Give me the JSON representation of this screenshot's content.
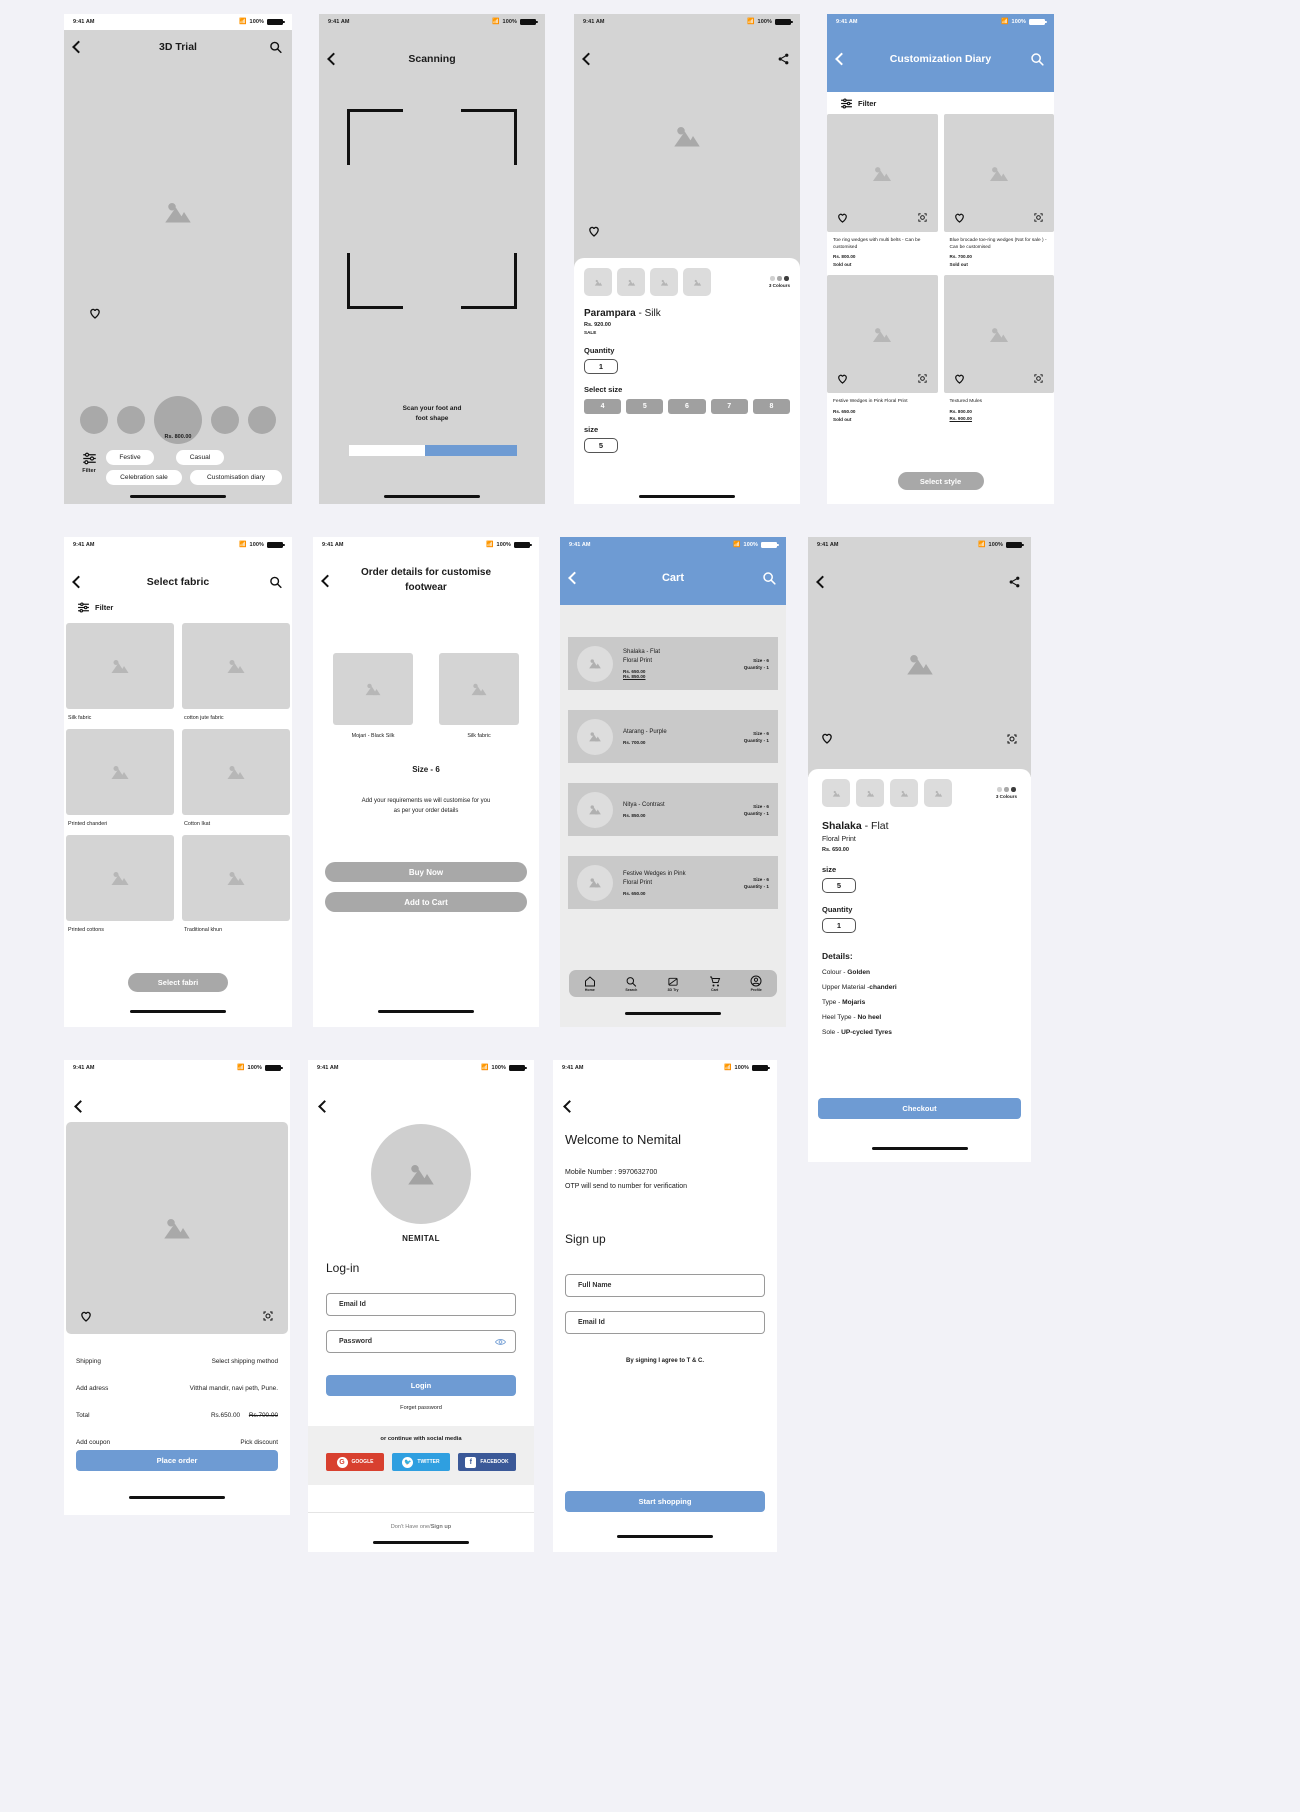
{
  "meta": {
    "status_time": "9:41 AM",
    "battery": "100%"
  },
  "colors": {
    "accent": "#6e9bd3",
    "placeholder": "#d4d4d4",
    "muted": "#a8a8a8"
  },
  "screens": {
    "trial3d": {
      "title": "3D Trial",
      "price": "Rs. 800.00",
      "filter_label": "Filter",
      "chips": [
        "Festive",
        "Casual",
        "Celebration sale",
        "Customisation diary"
      ]
    },
    "scanning": {
      "title": "Scanning",
      "instruction_line1": "Scan your foot and",
      "instruction_line2": "foot shape"
    },
    "product": {
      "name_bold": "Parampara",
      "name_rest": "- Silk",
      "price": "Rs. 920.00",
      "tag": "SALE",
      "quantity_label": "Quantity",
      "quantity_value": "1",
      "select_size_label": "Select size",
      "sizes": [
        "4",
        "5",
        "6",
        "7",
        "8"
      ],
      "size_label": "size",
      "size_value": "5",
      "colours_label": "3 Colours"
    },
    "diary": {
      "title": "Customization Diary",
      "filter_label": "Filter",
      "cta": "Select style",
      "items": [
        {
          "name": "Toe ring wedges with multi belts - Can be customised",
          "price": "Rs. 800.00",
          "status": "Sold out"
        },
        {
          "name": "Blue brocade toe-ring wedges (Not for sale ) - Can be customised",
          "price": "Rs. 700.00",
          "status": "Sold out"
        },
        {
          "name": "Festive Wedges in Pink Floral Print",
          "price": "Rs. 650.00",
          "status": "Sold out"
        },
        {
          "name": "Textured Mules",
          "price": "Rs. 800.00",
          "price_old": "Rs. 900.00",
          "status": ""
        }
      ]
    },
    "fabric": {
      "title": "Select fabric",
      "filter_label": "Filter",
      "cta": "Select fabri",
      "items": [
        "Silk fabric",
        "cotton jute fabric",
        "Printed chanderi",
        "Cotton Ikat",
        "Printed cottons",
        "Traditional khun"
      ]
    },
    "order": {
      "title_line1": "Order details for customise",
      "title_line2": "footwear",
      "item_left": "Mojari - Black Silk",
      "item_right": "Silk fabric",
      "size": "Size - 6",
      "note_line1": "Add your requirements we will customise for you",
      "note_line2": "as per your order details",
      "buy_now": "Buy Now",
      "add_to_cart": "Add to Cart"
    },
    "cart": {
      "title": "Cart",
      "items": [
        {
          "name_line1": "Shalaka - Flat",
          "name_line2": "Floral Print",
          "price": "Rs. 650.00",
          "price_old": "Rs. 850.00",
          "size": "Size - 6",
          "qty": "Quantity - 1"
        },
        {
          "name_line1": "Atarang - Purple",
          "name_line2": "",
          "price": "Rs. 700.00",
          "price_old": "",
          "size": "Size - 6",
          "qty": "Quantity - 1"
        },
        {
          "name_line1": "Nitya - Contrast",
          "name_line2": "",
          "price": "Rs. 850.00",
          "price_old": "",
          "size": "Size - 6",
          "qty": "Quantity - 1"
        },
        {
          "name_line1": "Festive Wedges in Pink",
          "name_line2": "Floral Print",
          "price": "Rs. 650.00",
          "price_old": "",
          "size": "Size - 6",
          "qty": "Quantity - 1"
        }
      ],
      "tabs": [
        "Home",
        "Search",
        "3D Try",
        "Cart",
        "Profile"
      ]
    },
    "detail": {
      "name_bold": "Shalaka",
      "name_rest": "- Flat",
      "subtitle": "Floral Print",
      "price": "Rs. 650.00",
      "size_label": "size",
      "size_value": "5",
      "quantity_label": "Quantity",
      "quantity_value": "1",
      "details_label": "Details:",
      "colours_label": "3 Colours",
      "details": [
        {
          "key": "Colour - ",
          "val": "Golden"
        },
        {
          "key": "Upper Material -",
          "val": "chanderi"
        },
        {
          "key": "Type - ",
          "val": "Mojaris"
        },
        {
          "key": "Heel  Type - ",
          "val": "No heel"
        },
        {
          "key": "Sole - ",
          "val": "UP-cycled Tyres"
        }
      ],
      "checkout": "Checkout"
    },
    "shipping": {
      "rows": [
        {
          "left": "Shipping",
          "right": "Select shipping method"
        },
        {
          "left": "Add adress",
          "right": "Vitthal mandir, navi peth, Pune."
        },
        {
          "left": "Total",
          "right": "Rs.650.00",
          "right2": "Rs.700.00"
        },
        {
          "left": "Add coupon",
          "right": "Pick discount"
        }
      ],
      "cta": "Place order"
    },
    "login": {
      "brand": "NEMITAL",
      "heading": "Log-in",
      "email_placeholder": "Email Id",
      "password_placeholder": "Password",
      "login_btn": "Login",
      "forgot": "Forget password",
      "social_divider": "or continue with social media",
      "social": [
        "GOOGLE",
        "TWITTER",
        "FACEBOOK"
      ],
      "footer_plain": "Don't Have one/",
      "footer_link": "Sign up"
    },
    "signup": {
      "welcome": "Welcome to Nemital",
      "mobile": "Mobile Number : 9970632700",
      "otp_note": "OTP will send to number for verification",
      "heading": "Sign up",
      "fullname_placeholder": "Full Name",
      "email_placeholder": "Email Id",
      "terms": "By signing I agree to T & C.",
      "cta": "Start shopping"
    }
  }
}
